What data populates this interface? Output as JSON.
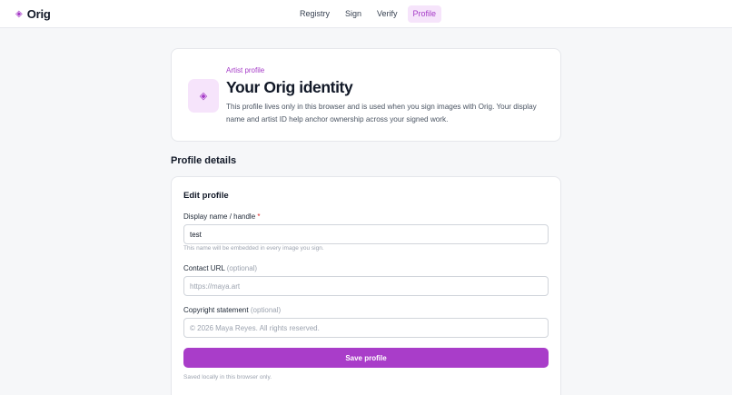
{
  "app": {
    "logo_icon": "diamond-icon",
    "name": "Orig",
    "accent": "#a53ac7"
  },
  "nav": {
    "tabs": [
      {
        "label": "Registry"
      },
      {
        "label": "Sign"
      },
      {
        "label": "Verify"
      },
      {
        "label": "Profile",
        "active": true
      }
    ]
  },
  "hero": {
    "icon": "diamond-icon",
    "eyebrow": "Artist profile",
    "title": "Your Orig identity",
    "description": "This profile lives only in this browser and is used when you sign images with Orig. Your display name and artist ID help anchor ownership across your signed work."
  },
  "section_title": "Profile details",
  "form": {
    "heading": "Edit profile",
    "display_name": {
      "label": "Display name / handle",
      "required_mark": "*",
      "value": "test",
      "hint": "This name will be embedded in every image you sign."
    },
    "contact_url": {
      "label": "Contact URL",
      "optional": "(optional)",
      "value": "",
      "placeholder": "https://maya.art"
    },
    "copyright": {
      "label": "Copyright statement",
      "optional": "(optional)",
      "value": "",
      "placeholder": "© 2026 Maya Reyes. All rights reserved."
    },
    "save_label": "Save profile",
    "footnote": "Saved locally in this browser only."
  }
}
